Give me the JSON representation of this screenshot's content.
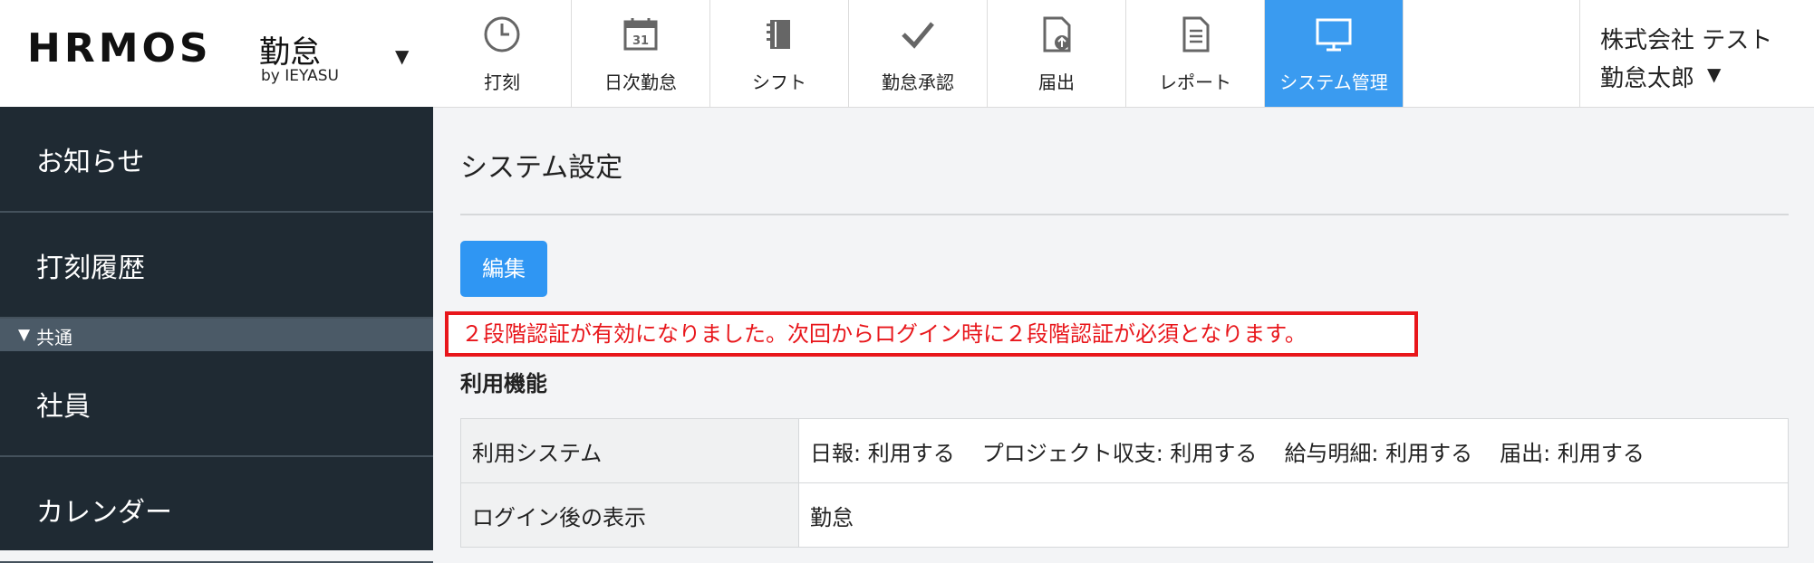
{
  "header": {
    "logo_main": "HRMOS",
    "logo_product": "勤怠",
    "logo_by": "by IEYASU",
    "nav": [
      {
        "label": "打刻",
        "icon": "clock-icon"
      },
      {
        "label": "日次勤怠",
        "icon": "calendar-icon"
      },
      {
        "label": "シフト",
        "icon": "notebook-icon"
      },
      {
        "label": "勤怠承認",
        "icon": "checkmark-icon"
      },
      {
        "label": "届出",
        "icon": "document-upload-icon"
      },
      {
        "label": "レポート",
        "icon": "report-icon"
      },
      {
        "label": "システム管理",
        "icon": "monitor-icon",
        "active": true
      }
    ],
    "company": "株式会社 テスト",
    "username": "勤怠太郎"
  },
  "sidebar": {
    "items": [
      {
        "label": "お知らせ"
      },
      {
        "label": "打刻履歴"
      }
    ],
    "group": {
      "label": "共通"
    },
    "group_items": [
      {
        "label": "社員"
      },
      {
        "label": "カレンダー"
      }
    ]
  },
  "main": {
    "page_title": "システム設定",
    "edit_label": "編集",
    "notice": "２段階認証が有効になりました。次回からログイン時に２段階認証が必須となります。",
    "section_title": "利用機能",
    "rows": [
      {
        "key": "利用システム",
        "values": [
          "日報: 利用する",
          "プロジェクト収支: 利用する",
          "給与明細: 利用する",
          "届出: 利用する"
        ]
      },
      {
        "key": "ログイン後の表示",
        "values": [
          "勤怠"
        ]
      }
    ]
  },
  "colors": {
    "accent": "#3a9bf0",
    "sidebar_bg": "#1f2a33",
    "notice_red": "#e8161b"
  }
}
